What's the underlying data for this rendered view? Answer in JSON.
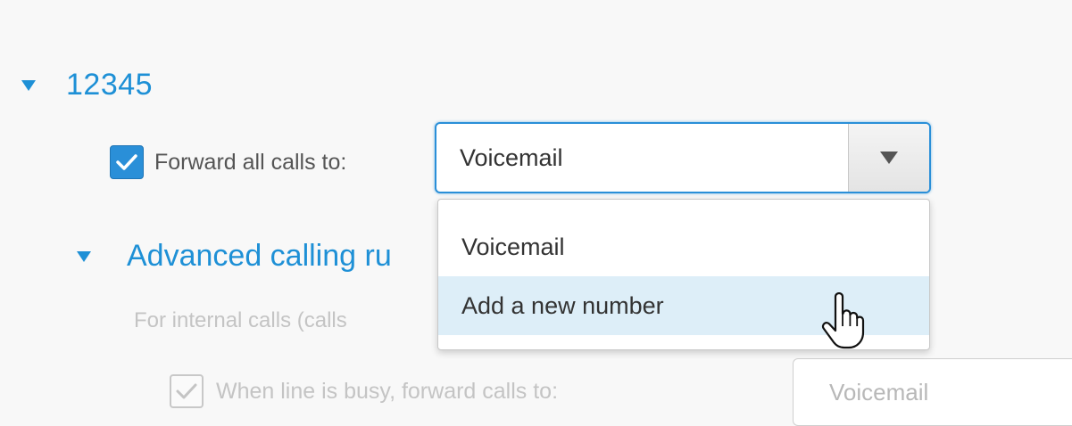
{
  "section": {
    "title": "12345",
    "expand_icon": "triangle-down-icon"
  },
  "forward_all": {
    "checked": true,
    "label": "Forward all calls to:",
    "select_value": "Voicemail",
    "dropdown_icon": "chevron-down-icon"
  },
  "dropdown": {
    "options": [
      "Voicemail",
      "Add a new number"
    ],
    "highlighted": "Add a new number"
  },
  "advanced": {
    "title": "Advanced calling ru",
    "expand_icon": "triangle-down-icon",
    "internal_label": "For internal calls (calls",
    "busy_label": "When line is busy, forward calls to:",
    "busy_checked": true,
    "busy_select_value": "Voicemail"
  },
  "cursor": {
    "icon": "hand-pointer-icon"
  },
  "colors": {
    "accent": "#1e90d6",
    "checkbox": "#2a8fd8",
    "highlight": "#ddeef8",
    "disabled_text": "#c4c4c4"
  }
}
